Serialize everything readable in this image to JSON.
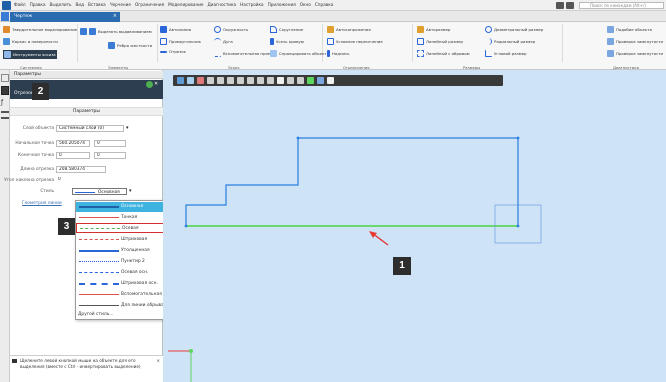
{
  "titlebar": {
    "menu": [
      "Файл",
      "Правка",
      "Выделить",
      "Вид",
      "Вставка",
      "Черчение",
      "Ограничения",
      "Моделирование",
      "Диагностика",
      "Настройка",
      "Приложения",
      "Окно",
      "Справка"
    ],
    "search_placeholder": "Поиск по командам (Alt+/)"
  },
  "tab": {
    "label": "Чертеж",
    "close": "×"
  },
  "ribbon": {
    "groups": [
      {
        "label": "Системная",
        "items": [
          "Твердотельное моделирование",
          "Каркас и поверхности",
          "Инструменты эскиза"
        ]
      },
      {
        "label": "Элементы",
        "items": [
          "Вырезать выдавливанием",
          "Ребро жесткости"
        ]
      },
      {
        "label": "Эскиз",
        "items": [
          "Автолиния",
          "Прямоугольник",
          "Отрезок",
          "Окружность",
          "Дуга",
          "Вспомогательная прямая",
          "Скругление",
          "Усечь кривую",
          "Спроецировать объект"
        ]
      },
      {
        "label": "Ограничения",
        "items": [
          "Автосопряжение",
          "Условное пересечение",
          "Надпись"
        ]
      },
      {
        "label": "Размеры",
        "items": [
          "Авторазмер",
          "Линейный размер",
          "Линейный с обрывом",
          "Диаметральный размер",
          "Радиальный размер",
          "Угловой размер"
        ]
      },
      {
        "label": "Диагностика",
        "items": [
          "Подобие объекта",
          "Проверка замкнутости",
          "Проверка замкнутости"
        ]
      }
    ]
  },
  "panel": {
    "header": "Параметры",
    "subheader": "Отрезок",
    "section_title": "Параметры",
    "fields": [
      {
        "label": "Слой объекта",
        "value": "Системный слой (0)"
      },
      {
        "label": "Начальная точка",
        "value": "560.205074",
        "value2": "0"
      },
      {
        "label": "Конечная точка",
        "value": "0",
        "value2": "0"
      },
      {
        "label": "Длина отрезка",
        "value": "208.580374"
      },
      {
        "label": "Угол наклона отрезка",
        "value": "0"
      },
      {
        "label": "Стиль",
        "value": "Основная"
      }
    ],
    "link_label": "Геометрия линии",
    "styles": [
      "Основная",
      "Тонкая",
      "Осевая",
      "Штриховая",
      "Утолщенная",
      "Пунктир 2",
      "Осевая осн.",
      "Штриховая осн.",
      "Вспомогательная",
      "Для линии обрыва"
    ],
    "other_styles": "Другой стиль...",
    "hint": "Щелкните левой кнопкой мыши на объекте для его выделения (вместе с Ctrl - инвертировать выделение)",
    "hint_close": "×"
  },
  "callouts": {
    "one": "1",
    "two": "2",
    "three": "3"
  },
  "colors": {
    "accent": "#2b6cb0",
    "selected_style": "#3fb3e0",
    "callout_box": "#d32f2f",
    "canvas": "#cfe3f7",
    "drawing_line": "#2a7fe0",
    "selected_line": "#5cd65c",
    "arrow": "#e53935"
  }
}
